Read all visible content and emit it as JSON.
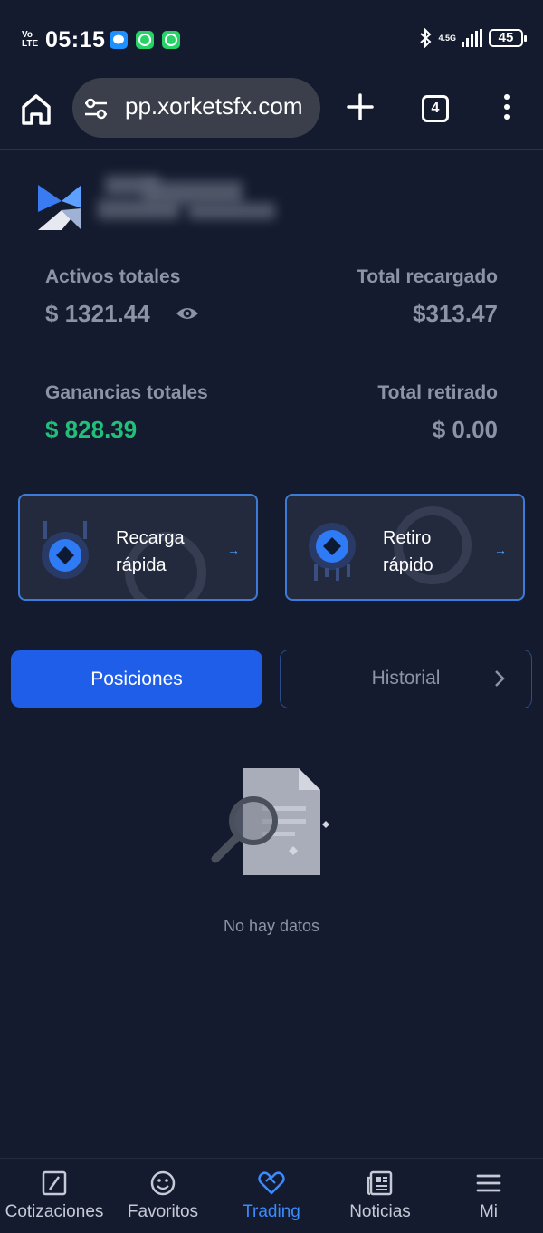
{
  "status_bar": {
    "carrier": "Vo LTE",
    "time": "05:15",
    "network": "4.5G",
    "battery": "45"
  },
  "browser": {
    "url": "pp.xorketsfx.com",
    "tab_count": "4"
  },
  "account": {
    "total_assets_label": "Activos totales",
    "total_assets_value": "$ 1321.44",
    "total_recharged_label": "Total recargado",
    "total_recharged_value": "$313.47",
    "total_earnings_label": "Ganancias totales",
    "total_earnings_value": "$ 828.39",
    "total_withdrawn_label": "Total retirado",
    "total_withdrawn_value": "$ 0.00"
  },
  "quick_actions": {
    "recharge_line1": "Recarga",
    "recharge_line2": "rápida",
    "withdraw_line1": "Retiro",
    "withdraw_line2": "rápido"
  },
  "tabs": {
    "positions": "Posiciones",
    "history": "Historial"
  },
  "empty_state": {
    "text": "No hay datos"
  },
  "bottom_nav": [
    {
      "label": "Cotizaciones",
      "icon": "chart-icon"
    },
    {
      "label": "Favoritos",
      "icon": "smiley-icon"
    },
    {
      "label": "Trading",
      "icon": "handshake-icon"
    },
    {
      "label": "Noticias",
      "icon": "newspaper-icon"
    },
    {
      "label": "Mi",
      "icon": "hamburger-icon"
    }
  ],
  "colors": {
    "background": "#141b2e",
    "accent": "#1f5ee8",
    "profit": "#21c07a",
    "active_nav": "#3a8bff",
    "muted_text": "#8c93a6"
  }
}
